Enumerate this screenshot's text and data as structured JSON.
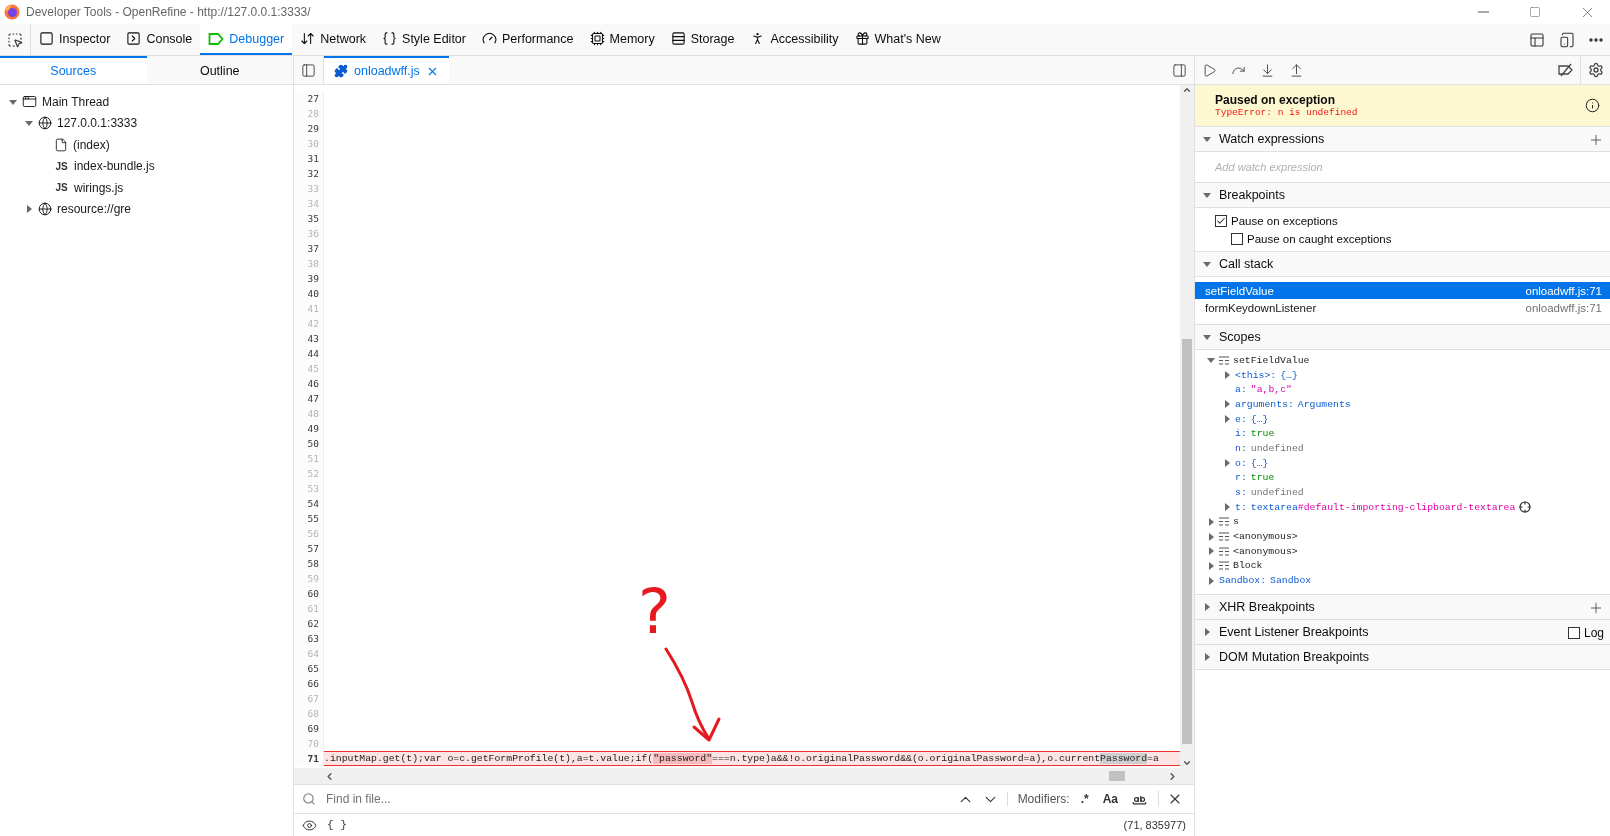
{
  "window": {
    "title": "Developer Tools - OpenRefine - http://127.0.0.1:3333/"
  },
  "toolbar": {
    "tabs": [
      {
        "label": "Inspector",
        "selected": false
      },
      {
        "label": "Console",
        "selected": false
      },
      {
        "label": "Debugger",
        "selected": true
      },
      {
        "label": "Network",
        "selected": false
      },
      {
        "label": "Style Editor",
        "selected": false
      },
      {
        "label": "Performance",
        "selected": false
      },
      {
        "label": "Memory",
        "selected": false
      },
      {
        "label": "Storage",
        "selected": false
      },
      {
        "label": "Accessibility",
        "selected": false
      },
      {
        "label": "What's New",
        "selected": false
      }
    ]
  },
  "sources_panel": {
    "tabs": [
      {
        "label": "Sources",
        "selected": true
      },
      {
        "label": "Outline",
        "selected": false
      }
    ],
    "tree": [
      {
        "label": "Main Thread",
        "kind": "thread",
        "expanded": true,
        "children": [
          {
            "label": "127.0.0.1:3333",
            "kind": "domain",
            "expanded": true,
            "children": [
              {
                "label": "(index)",
                "kind": "file"
              },
              {
                "label": "index-bundle.js",
                "kind": "js",
                "icon_label": "JS"
              },
              {
                "label": "wirings.js",
                "kind": "js",
                "icon_label": "JS"
              }
            ]
          },
          {
            "label": "resource://gre",
            "kind": "domain",
            "expanded": false
          }
        ]
      }
    ]
  },
  "editor": {
    "tabs": [
      {
        "label": "onloadwff.js",
        "selected": true
      }
    ],
    "lines": [
      {
        "number": "27",
        "breakable": true,
        "paused": false
      },
      {
        "number": "28",
        "breakable": false,
        "paused": false
      },
      {
        "number": "29",
        "breakable": true,
        "paused": false
      },
      {
        "number": "30",
        "breakable": false,
        "paused": false
      },
      {
        "number": "31",
        "breakable": true,
        "paused": false
      },
      {
        "number": "32",
        "breakable": true,
        "paused": false
      },
      {
        "number": "33",
        "breakable": false,
        "paused": false
      },
      {
        "number": "34",
        "breakable": false,
        "paused": false
      },
      {
        "number": "35",
        "breakable": true,
        "paused": false
      },
      {
        "number": "36",
        "breakable": false,
        "paused": false
      },
      {
        "number": "37",
        "breakable": true,
        "paused": false
      },
      {
        "number": "38",
        "breakable": false,
        "paused": false
      },
      {
        "number": "39",
        "breakable": true,
        "paused": false
      },
      {
        "number": "40",
        "breakable": true,
        "paused": false
      },
      {
        "number": "41",
        "breakable": false,
        "paused": false
      },
      {
        "number": "42",
        "breakable": false,
        "paused": false
      },
      {
        "number": "43",
        "breakable": true,
        "paused": false
      },
      {
        "number": "44",
        "breakable": true,
        "paused": false
      },
      {
        "number": "45",
        "breakable": false,
        "paused": false
      },
      {
        "number": "46",
        "breakable": true,
        "paused": false
      },
      {
        "number": "47",
        "breakable": true,
        "paused": false
      },
      {
        "number": "48",
        "breakable": false,
        "paused": false
      },
      {
        "number": "49",
        "breakable": true,
        "paused": false
      },
      {
        "number": "50",
        "breakable": true,
        "paused": false
      },
      {
        "number": "51",
        "breakable": false,
        "paused": false
      },
      {
        "number": "52",
        "breakable": false,
        "paused": false
      },
      {
        "number": "53",
        "breakable": false,
        "paused": false
      },
      {
        "number": "54",
        "breakable": true,
        "paused": false
      },
      {
        "number": "55",
        "breakable": true,
        "paused": false
      },
      {
        "number": "56",
        "breakable": false,
        "paused": false
      },
      {
        "number": "57",
        "breakable": true,
        "paused": false
      },
      {
        "number": "58",
        "breakable": true,
        "paused": false
      },
      {
        "number": "59",
        "breakable": false,
        "paused": false
      },
      {
        "number": "60",
        "breakable": true,
        "paused": false
      },
      {
        "number": "61",
        "breakable": false,
        "paused": false
      },
      {
        "number": "62",
        "breakable": true,
        "paused": false
      },
      {
        "number": "63",
        "breakable": true,
        "paused": false
      },
      {
        "number": "64",
        "breakable": false,
        "paused": false
      },
      {
        "number": "65",
        "breakable": true,
        "paused": false
      },
      {
        "number": "66",
        "breakable": true,
        "paused": false
      },
      {
        "number": "67",
        "breakable": false,
        "paused": false
      },
      {
        "number": "68",
        "breakable": false,
        "paused": false
      },
      {
        "number": "69",
        "breakable": true,
        "paused": false
      },
      {
        "number": "70",
        "breakable": false,
        "paused": false
      },
      {
        "number": "71",
        "breakable": true,
        "paused": true,
        "segments": [
          {
            "text": ".inputMap.get(t);var o=c.getFormProfile(t),a=t.value;if(",
            "kind": "plain"
          },
          {
            "text": "\"password\"",
            "kind": "error_highlight"
          },
          {
            "text": "===n.type)a&&!o.originalPassword&&(o.originalPassword=a),o.current",
            "kind": "plain"
          },
          {
            "text": "Password",
            "kind": "search_match"
          },
          {
            "text": "=a",
            "kind": "plain"
          }
        ]
      }
    ]
  },
  "annotation": {
    "mark": "?"
  },
  "find_bar": {
    "placeholder": "Find in file...",
    "modifiers_label": "Modifiers:",
    "regex_label": ".*",
    "case_label": "Aa"
  },
  "status_bar": {
    "pretty_print": "{ }",
    "position": "(71, 835977)"
  },
  "debugger_panel": {
    "paused": {
      "title": "Paused on exception",
      "message": "TypeError: n is undefined"
    },
    "sections": [
      {
        "kind": "watch",
        "title": "Watch expressions",
        "expanded": true,
        "placeholder": "Add watch expression"
      },
      {
        "kind": "breakpoints",
        "title": "Breakpoints",
        "expanded": true,
        "options": [
          {
            "label": "Pause on exceptions",
            "checked": true
          },
          {
            "label": "Pause on caught exceptions",
            "checked": false
          }
        ]
      },
      {
        "kind": "callstack",
        "title": "Call stack",
        "expanded": true,
        "frames": [
          {
            "name": "setFieldValue",
            "location": "onloadwff.js:71",
            "selected": true
          },
          {
            "name": "formKeydownListener",
            "location": "onloadwff.js:71",
            "selected": false
          }
        ]
      },
      {
        "kind": "scopes",
        "title": "Scopes",
        "expanded": true,
        "tree": [
          {
            "kind": "scope",
            "label": "setFieldValue",
            "expanded": true,
            "children": [
              {
                "kind": "object",
                "name": "<this>:",
                "value": "{…}",
                "expanded": false
              },
              {
                "kind": "string",
                "name": "a:",
                "value": "\"a,b,c\""
              },
              {
                "kind": "object",
                "name": "arguments:",
                "value": "Arguments",
                "expanded": false
              },
              {
                "kind": "object",
                "name": "e:",
                "value": "{…}",
                "expanded": false
              },
              {
                "kind": "boolean",
                "name": "i:",
                "value": "true"
              },
              {
                "kind": "undefined",
                "name": "n:",
                "value": "undefined"
              },
              {
                "kind": "object",
                "name": "o:",
                "value": "{…}",
                "expanded": false
              },
              {
                "kind": "boolean",
                "name": "r:",
                "value": "true"
              },
              {
                "kind": "undefined",
                "name": "s:",
                "value": "undefined"
              },
              {
                "kind": "node",
                "name": "t:",
                "value": "textarea",
                "value_id": "#default-importing-clipboard-textarea",
                "expanded": false
              }
            ]
          },
          {
            "kind": "scope",
            "label": "s",
            "expanded": false
          },
          {
            "kind": "scope",
            "label": "<anonymous>",
            "expanded": false
          },
          {
            "kind": "scope",
            "label": "<anonymous>",
            "expanded": false
          },
          {
            "kind": "scope",
            "label": "Block",
            "expanded": false
          },
          {
            "kind": "object",
            "name": "Sandbox:",
            "value": "Sandbox",
            "expanded": false
          }
        ]
      },
      {
        "kind": "xhr",
        "title": "XHR Breakpoints",
        "expanded": false
      },
      {
        "kind": "events",
        "title": "Event Listener Breakpoints",
        "expanded": false,
        "log": {
          "label": "Log",
          "checked": false
        }
      },
      {
        "kind": "dom",
        "title": "DOM Mutation Breakpoints",
        "expanded": false
      }
    ]
  }
}
